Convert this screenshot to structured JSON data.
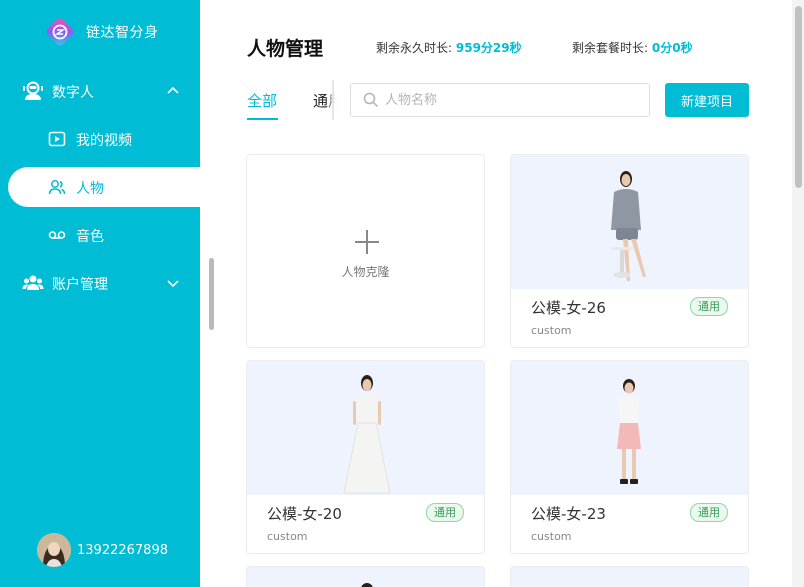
{
  "app": {
    "name": "链达智分身"
  },
  "sidebar": {
    "groups": [
      {
        "label": "数字人",
        "icon": "robot-icon",
        "expanded": true
      },
      {
        "label": "账户管理",
        "icon": "users-icon",
        "expanded": false
      }
    ],
    "items": [
      {
        "label": "我的视频",
        "icon": "video-icon",
        "active": false
      },
      {
        "label": "人物",
        "icon": "person-icon",
        "active": true
      },
      {
        "label": "音色",
        "icon": "voicemail-icon",
        "active": false
      }
    ]
  },
  "user": {
    "phone": "13922267898"
  },
  "header": {
    "title": "人物管理",
    "permanent_label": "剩余永久时长:",
    "permanent_value": "959分29秒",
    "package_label": "剩余套餐时长:",
    "package_value": "0分0秒"
  },
  "tabs": [
    {
      "label": "全部",
      "active": true
    },
    {
      "label": "通用",
      "active": false
    }
  ],
  "search": {
    "placeholder": "人物名称",
    "value": ""
  },
  "new_button": {
    "label": "新建项目"
  },
  "clone_card": {
    "label": "人物克隆"
  },
  "cards": [
    {
      "name": "公模-女-26",
      "sub": "custom",
      "tag": "通用"
    },
    {
      "name": "公模-女-20",
      "sub": "custom",
      "tag": "通用"
    },
    {
      "name": "公模-女-23",
      "sub": "custom",
      "tag": "通用"
    }
  ],
  "colors": {
    "accent": "#00bcd4",
    "tag_green": "#3a9a5c",
    "thumb_bg": "#eef3fd"
  }
}
